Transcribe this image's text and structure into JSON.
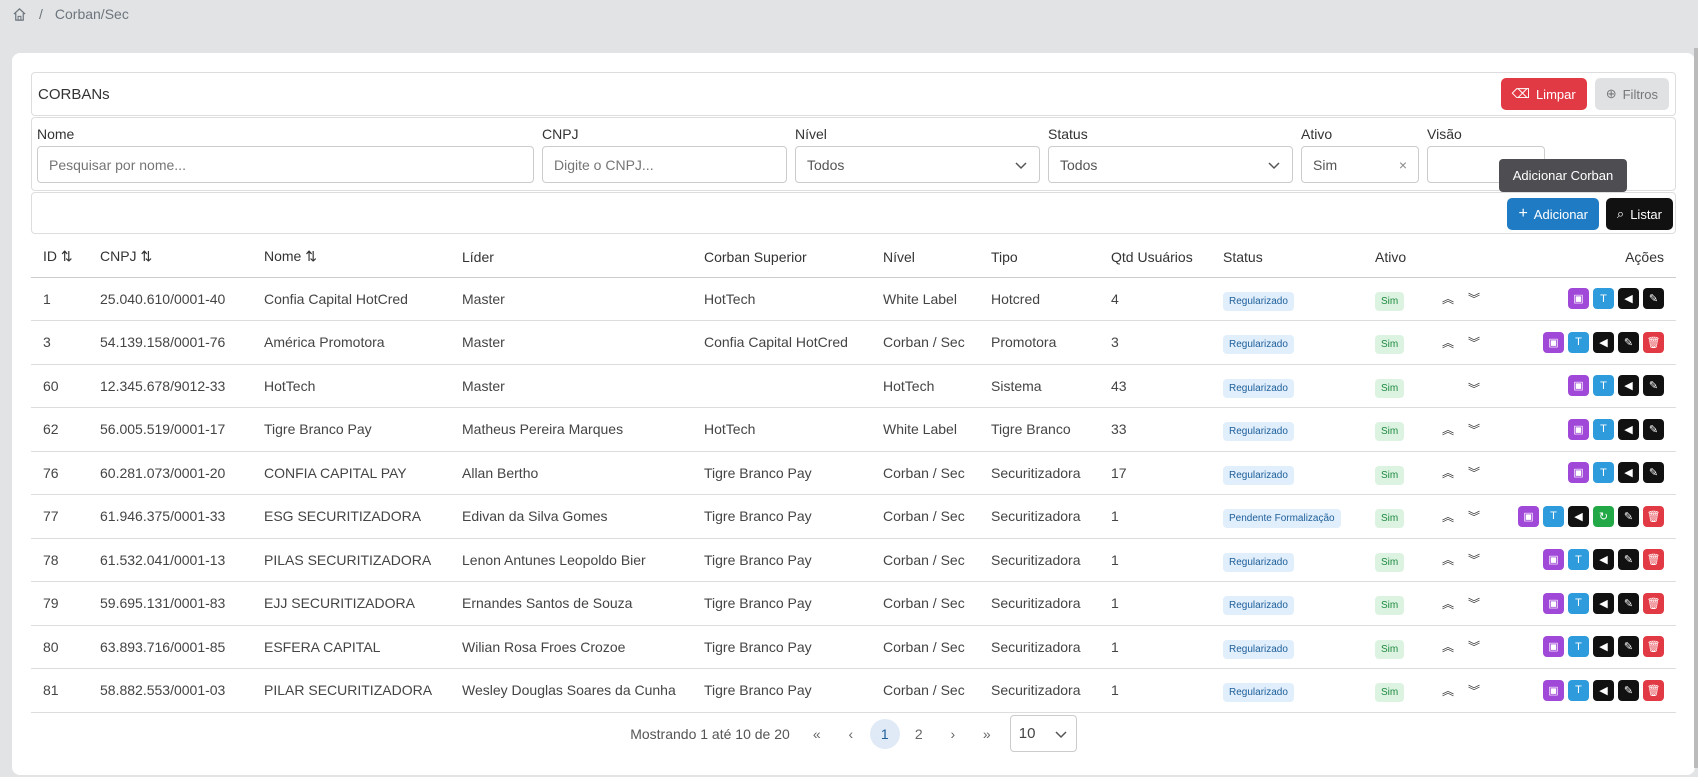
{
  "breadcrumb": {
    "current": "Corban/Sec"
  },
  "panel": {
    "title": "CORBANs",
    "clear_label": "Limpar",
    "filters_label": "Filtros"
  },
  "filters": {
    "nome_label": "Nome",
    "nome_placeholder": "Pesquisar por nome...",
    "cnpj_label": "CNPJ",
    "cnpj_placeholder": "Digite o CNPJ...",
    "nivel_label": "Nível",
    "nivel_value": "Todos",
    "status_label": "Status",
    "status_value": "Todos",
    "ativo_label": "Ativo",
    "ativo_value": "Sim",
    "visao_label": "Visão",
    "visao_value": ""
  },
  "toolbar": {
    "add_label": "Adicionar",
    "list_label": "Listar",
    "tooltip": "Adicionar Corban"
  },
  "table": {
    "headers": [
      "ID ⇅",
      "CNPJ ⇅",
      "Nome ⇅",
      "Líder",
      "Corban Superior",
      "Nível",
      "Tipo",
      "Qtd Usuários",
      "Status",
      "Ativo",
      "",
      "Ações"
    ],
    "rows": [
      {
        "id": "1",
        "cnpj": "25.040.610/0001-40",
        "nome": "Confia Capital HotCred",
        "lider": "Master",
        "superior": "HotTech",
        "nivel": "White Label",
        "tipo": "Hotcred",
        "qtd": "4",
        "status": "Regularizado",
        "ativo": "Sim"
      },
      {
        "id": "3",
        "cnpj": "54.139.158/0001-76",
        "nome": "América Promotora",
        "lider": "Master",
        "superior": "Confia Capital HotCred",
        "nivel": "Corban / Sec",
        "tipo": "Promotora",
        "qtd": "3",
        "status": "Regularizado",
        "ativo": "Sim"
      },
      {
        "id": "60",
        "cnpj": "12.345.678/9012-33",
        "nome": "HotTech",
        "lider": "Master",
        "superior": "",
        "nivel": "HotTech",
        "tipo": "Sistema",
        "qtd": "43",
        "status": "Regularizado",
        "ativo": "Sim"
      },
      {
        "id": "62",
        "cnpj": "56.005.519/0001-17",
        "nome": "Tigre Branco Pay",
        "lider": "Matheus Pereira Marques",
        "superior": "HotTech",
        "nivel": "White Label",
        "tipo": "Tigre Branco",
        "qtd": "33",
        "status": "Regularizado",
        "ativo": "Sim"
      },
      {
        "id": "76",
        "cnpj": "60.281.073/0001-20",
        "nome": "CONFIA CAPITAL PAY",
        "lider": "Allan Bertho",
        "superior": "Tigre Branco Pay",
        "nivel": "Corban / Sec",
        "tipo": "Securitizadora",
        "qtd": "17",
        "status": "Regularizado",
        "ativo": "Sim"
      },
      {
        "id": "77",
        "cnpj": "61.946.375/0001-33",
        "nome": "ESG SECURITIZADORA",
        "lider": "Edivan da Silva Gomes",
        "superior": "Tigre Branco Pay",
        "nivel": "Corban / Sec",
        "tipo": "Securitizadora",
        "qtd": "1",
        "status": "Pendente Formalização",
        "ativo": "Sim"
      },
      {
        "id": "78",
        "cnpj": "61.532.041/0001-13",
        "nome": "PILAS SECURITIZADORA",
        "lider": "Lenon Antunes Leopoldo Bier",
        "superior": "Tigre Branco Pay",
        "nivel": "Corban / Sec",
        "tipo": "Securitizadora",
        "qtd": "1",
        "status": "Regularizado",
        "ativo": "Sim"
      },
      {
        "id": "79",
        "cnpj": "59.695.131/0001-83",
        "nome": "EJJ SECURITIZADORA",
        "lider": "Ernandes Santos de Souza",
        "superior": "Tigre Branco Pay",
        "nivel": "Corban / Sec",
        "tipo": "Securitizadora",
        "qtd": "1",
        "status": "Regularizado",
        "ativo": "Sim"
      },
      {
        "id": "80",
        "cnpj": "63.893.716/0001-85",
        "nome": "ESFERA CAPITAL",
        "lider": "Wilian Rosa Froes Crozoe",
        "superior": "Tigre Branco Pay",
        "nivel": "Corban / Sec",
        "tipo": "Securitizadora",
        "qtd": "1",
        "status": "Regularizado",
        "ativo": "Sim"
      },
      {
        "id": "81",
        "cnpj": "58.882.553/0001-03",
        "nome": "PILAR SECURITIZADORA",
        "lider": "Wesley Douglas Soares da Cunha",
        "superior": "Tigre Branco Pay",
        "nivel": "Corban / Sec",
        "tipo": "Securitizadora",
        "qtd": "1",
        "status": "Regularizado",
        "ativo": "Sim"
      }
    ]
  },
  "pagination": {
    "info": "Mostrando 1 até 10 de 20",
    "first": "«",
    "prev": "‹",
    "page1": "1",
    "page2": "2",
    "next": "›",
    "last": "»",
    "page_size": "10"
  }
}
